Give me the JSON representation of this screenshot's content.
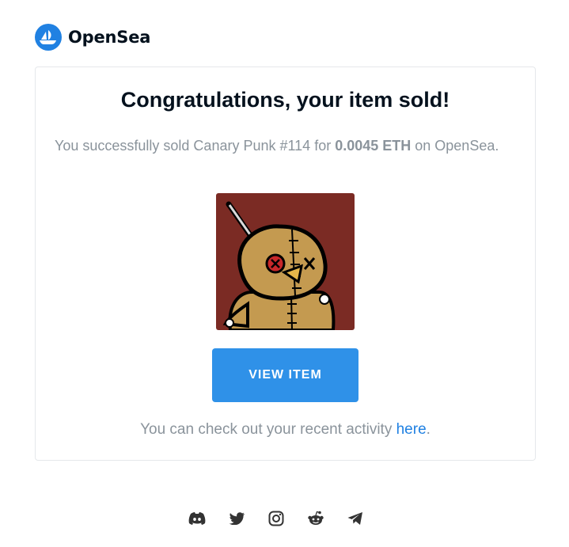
{
  "brand": {
    "name": "OpenSea",
    "color": "#2081e2",
    "icon": "opensea-ship-icon"
  },
  "card": {
    "title": "Congratulations, your item sold!",
    "message_prefix": "You successfully sold Canary Punk #114 for ",
    "price": "0.0045 ETH",
    "message_suffix": " on OpenSea.",
    "item_image": "canary-punk-voodoo-doll-image",
    "button_label": "VIEW ITEM",
    "activity_prefix": "You can check out your recent activity ",
    "activity_link": "here",
    "activity_suffix": "."
  },
  "colors": {
    "button": "#2f91e8",
    "nft_background": "#7b2b24",
    "muted_text": "#8a939b"
  },
  "social_icons": [
    "discord-icon",
    "twitter-icon",
    "instagram-icon",
    "reddit-icon",
    "telegram-icon"
  ]
}
